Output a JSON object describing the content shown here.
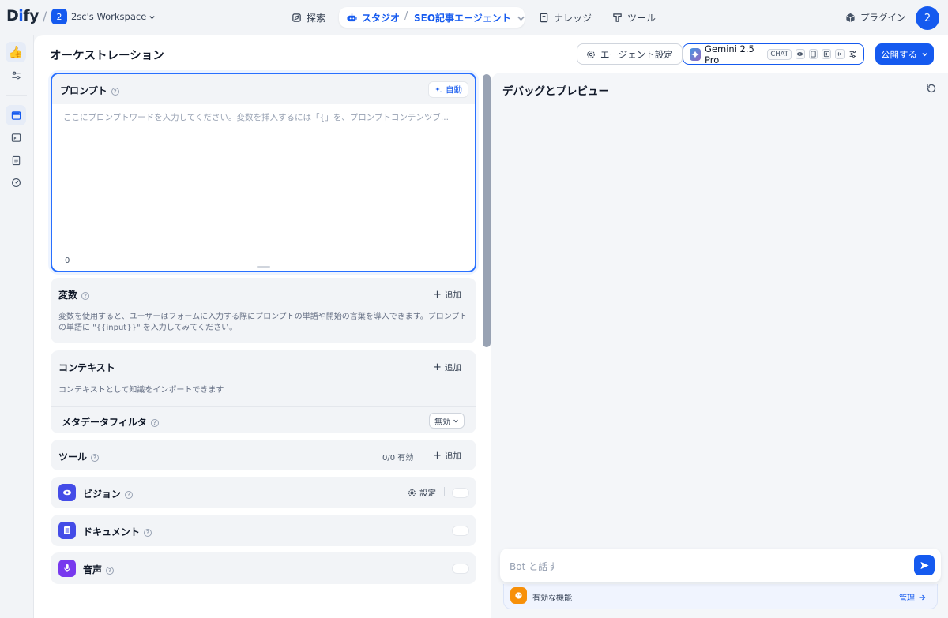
{
  "topbar": {
    "logo_text": "Dify",
    "workspace_badge": "2",
    "workspace_name": "2sc's Workspace",
    "nav_explore": "探索",
    "nav_studio": "スタジオ",
    "app_name": "SEO記事エージェント",
    "nav_knowledge": "ナレッジ",
    "nav_tools": "ツール",
    "plugins_label": "プラグイン",
    "avatar_initial": "2"
  },
  "header": {
    "title": "オーケストレーション",
    "agent_settings_label": "エージェント設定",
    "model_name": "Gemini 2.5 Pro",
    "model_mode": "CHAT",
    "publish_label": "公開する"
  },
  "prompt": {
    "title": "プロンプト",
    "auto_label": "自動",
    "placeholder": "ここにプロンプトワードを入力してください。変数を挿入するには「{」を、プロンプトコンテンツブ...",
    "char_count": "0"
  },
  "variables": {
    "title": "変数",
    "add_label": "追加",
    "description": "変数を使用すると、ユーザーはフォームに入力する際にプロンプトの単語や開始の言葉を導入できます。プロンプトの単語に \"{{input}}\" を入力してみてください。"
  },
  "context": {
    "title": "コンテキスト",
    "add_label": "追加",
    "description": "コンテキストとして知識をインポートできます",
    "metadata_filter_label": "メタデータフィルタ",
    "metadata_filter_value": "無効"
  },
  "tools": {
    "title": "ツール",
    "count_label": "0/0 有効",
    "add_label": "追加"
  },
  "features_list": {
    "vision_label": "ビジョン",
    "vision_settings_label": "設定",
    "document_label": "ドキュメント",
    "audio_label": "音声"
  },
  "debug": {
    "title": "デバッグとプレビュー",
    "input_placeholder": "Bot と話す",
    "enabled_features_label": "有効な機能",
    "manage_label": "管理"
  },
  "colors": {
    "accent": "#155aef",
    "vision_icon_bg": "#444ce7",
    "document_icon_bg": "#444ce7",
    "audio_icon_bg": "#7839ee",
    "features_icon_bg": "#f79009"
  }
}
